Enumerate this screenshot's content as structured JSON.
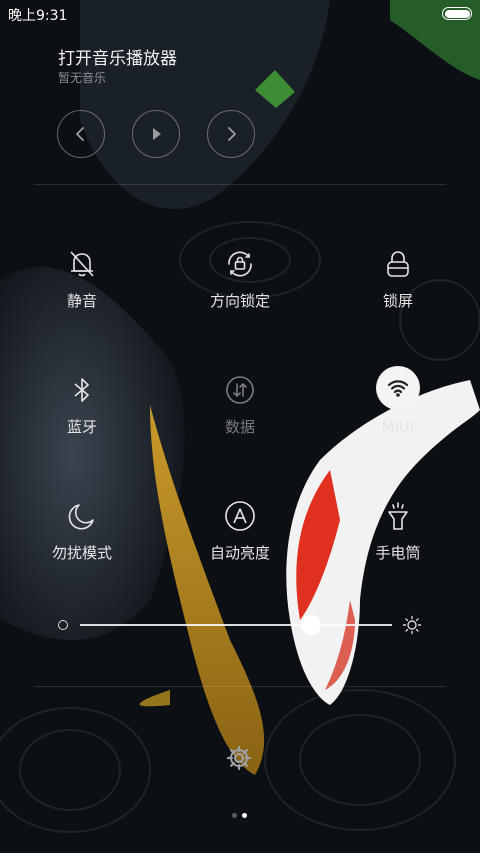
{
  "status_bar": {
    "time": "晚上9:31",
    "battery_level": 1.0
  },
  "music": {
    "title": "打开音乐播放器",
    "subtitle": "暂无音乐",
    "controls": [
      "prev-icon",
      "play-icon",
      "next-icon"
    ]
  },
  "toggles": [
    {
      "label": "静音",
      "icon": "bell-off-icon",
      "state": "off"
    },
    {
      "label": "方向锁定",
      "icon": "rotation-lock-icon",
      "state": "off"
    },
    {
      "label": "锁屏",
      "icon": "lock-icon",
      "state": "off"
    },
    {
      "label": "蓝牙",
      "icon": "bluetooth-icon",
      "state": "off"
    },
    {
      "label": "数据",
      "icon": "mobile-data-icon",
      "state": "disabled"
    },
    {
      "label": "MIUI",
      "icon": "wifi-icon",
      "state": "on"
    },
    {
      "label": "勿扰模式",
      "icon": "moon-icon",
      "state": "off"
    },
    {
      "label": "自动亮度",
      "icon": "auto-brightness-icon",
      "state": "off"
    },
    {
      "label": "手电筒",
      "icon": "flashlight-icon",
      "state": "off"
    }
  ],
  "brightness": {
    "level": 0.74
  },
  "pager": {
    "pages": 2,
    "current": 2
  },
  "colors": {
    "text_primary": "#e6e6e6",
    "text_dim": "#7a7c80",
    "active_bg": "#f4f4f4",
    "active_fg": "#222222"
  }
}
